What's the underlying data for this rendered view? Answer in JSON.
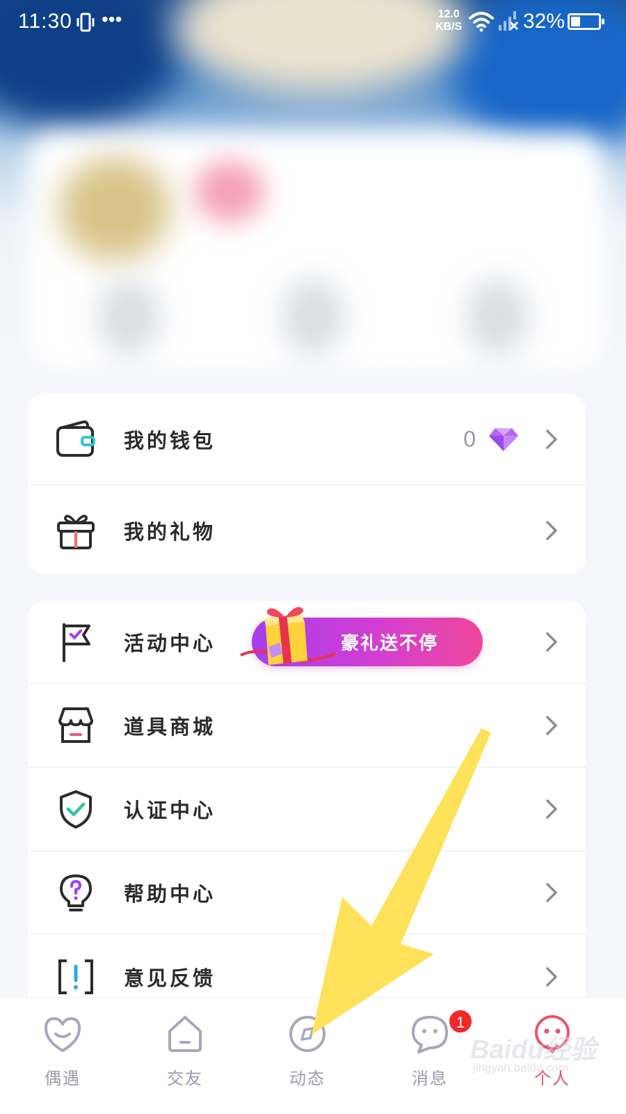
{
  "status_bar": {
    "time": "11:30",
    "dots": "•••",
    "speed_value": "12.0",
    "speed_unit": "KB/S",
    "battery": "32%",
    "battery_level_percent": 32,
    "icons": [
      "vibrate-icon",
      "wifi-icon",
      "signal-icon",
      "battery-icon"
    ]
  },
  "menu_group_1": [
    {
      "label": "我的钱包",
      "icon": "wallet-icon",
      "value": "0",
      "value_icon": "diamond-icon"
    },
    {
      "label": "我的礼物",
      "icon": "gift-icon"
    }
  ],
  "menu_group_2": [
    {
      "label": "活动中心",
      "icon": "flag-icon",
      "promo": "豪礼送不停"
    },
    {
      "label": "道具商城",
      "icon": "store-icon"
    },
    {
      "label": "认证中心",
      "icon": "shield-check-icon"
    },
    {
      "label": "帮助中心",
      "icon": "help-bulb-icon"
    },
    {
      "label": "意见反馈",
      "icon": "feedback-icon"
    }
  ],
  "bottom_nav": [
    {
      "label": "偶遇",
      "icon": "heart-smile-icon"
    },
    {
      "label": "交友",
      "icon": "home-icon"
    },
    {
      "label": "动态",
      "icon": "compass-icon"
    },
    {
      "label": "消息",
      "icon": "chat-face-icon",
      "badge": "1"
    },
    {
      "label": "个人",
      "icon": "profile-face-icon",
      "active": true
    }
  ],
  "watermark": {
    "main": "Baidu经验",
    "sub": "jingyan.baidu.com"
  },
  "colors": {
    "accent_purple": "#a63df0",
    "accent_pink": "#f0479c",
    "active_nav": "#e8536b",
    "badge_red": "#f02828",
    "arrow_yellow": "#ffe15a",
    "shield_green": "#2ec6a0"
  }
}
